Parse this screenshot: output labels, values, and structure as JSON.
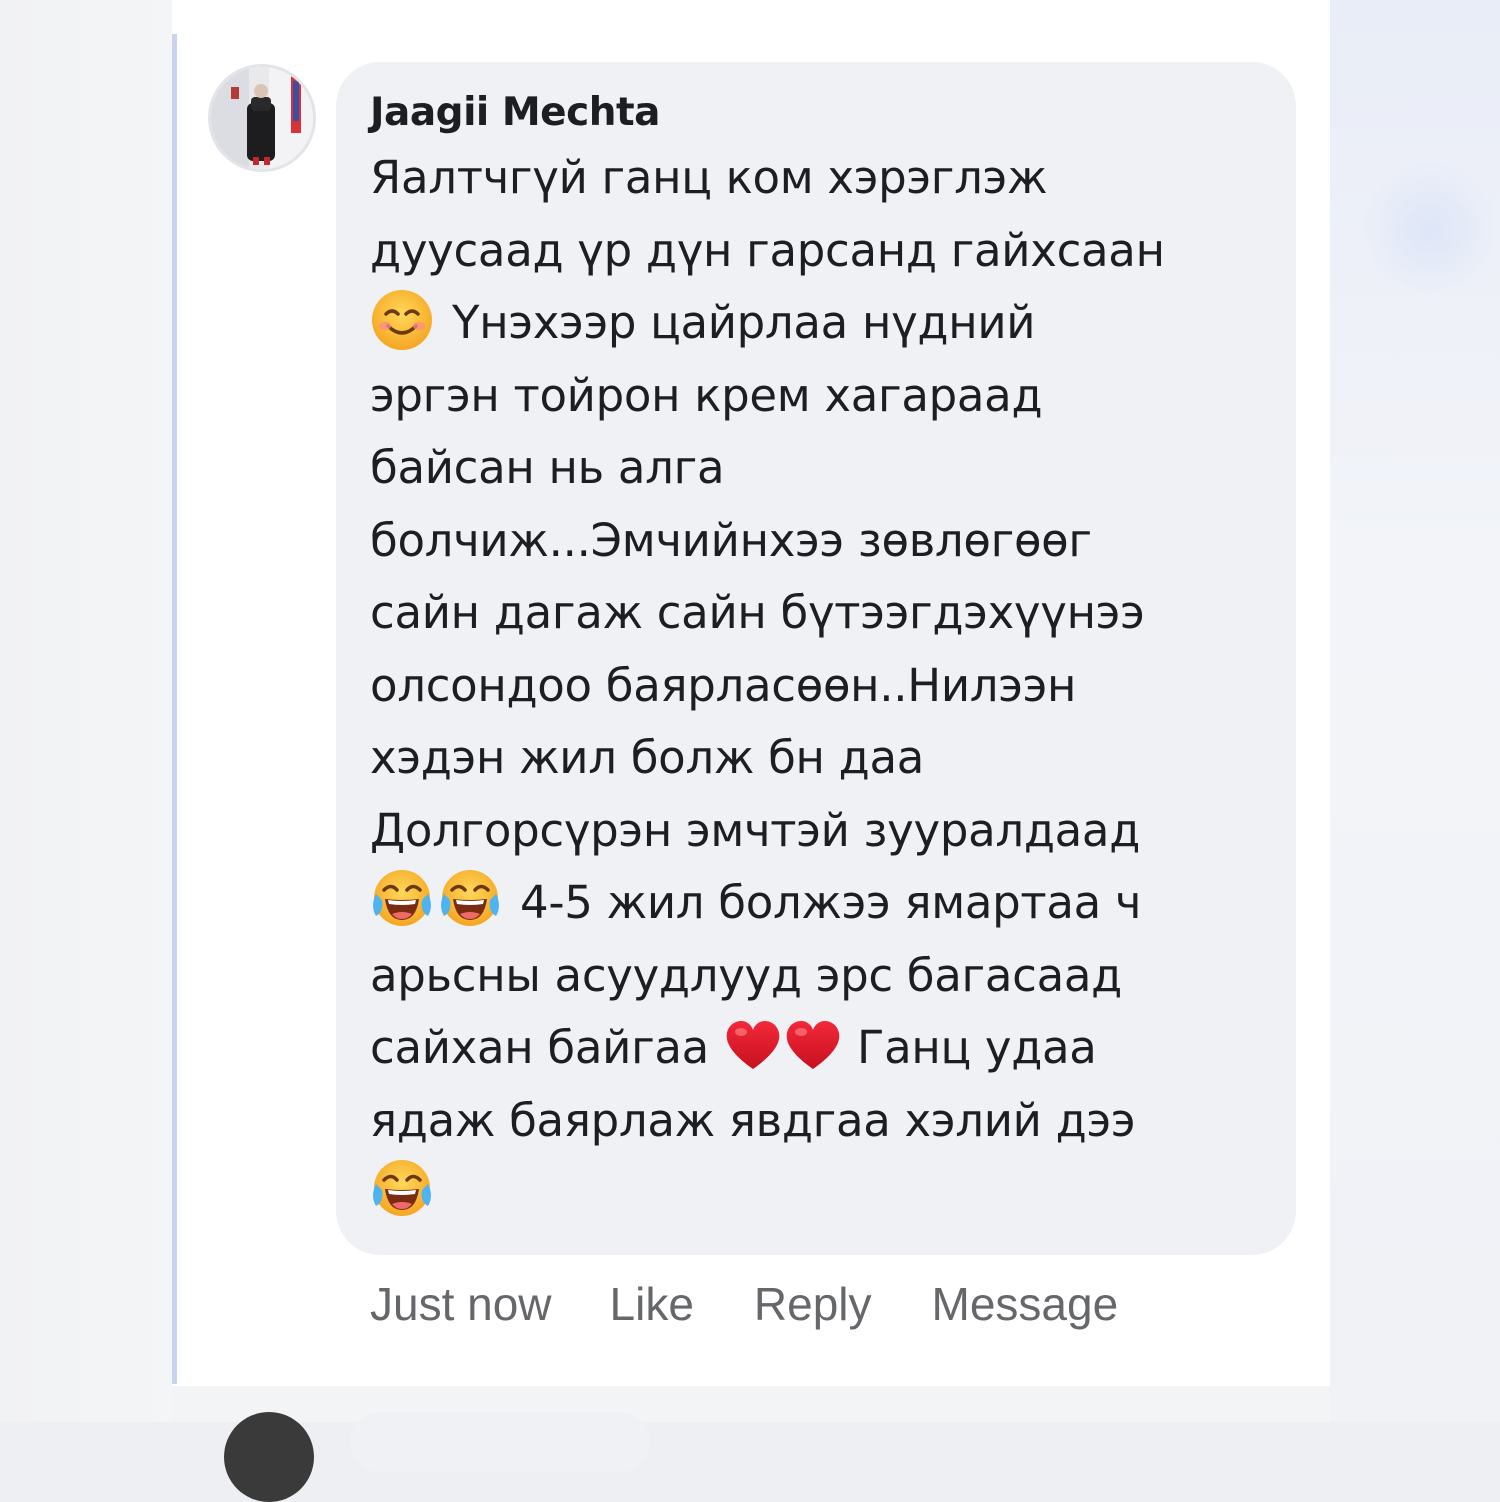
{
  "comment": {
    "author": "Jaagii Mechta",
    "text_lines": [
      "Яалтчгүй ганц ком хэрэглэж",
      "дуусаад үр дүн гарсанд гайхсаан",
      "Үнэхээр цайрлаа нүдний",
      "эргэн тойрон крем хагараад",
      "байсан нь алга",
      "болчиж...Эмчийнхээ зөвлөгөөг",
      "сайн дагаж сайн бүтээгдэхүүнээ",
      "олсондоо баярласөөн..Нилээн",
      "хэдэн жил болж бн даа",
      "Долгорсүрэн эмчтэй зууралдаад",
      "4-5 жил болжээ ямартаа ч",
      "арьсны асуудлууд эрс багасаад",
      "сайхан байгаа",
      "Ганц удаа",
      "ядаж баярлаж явдгаа хэлий дээ"
    ],
    "emojis": {
      "smiling": "smiling-face-emoji",
      "laughing": "face-with-tears-of-joy-emoji",
      "heart": "red-heart-emoji"
    }
  },
  "actions": {
    "timestamp": "Just now",
    "like": "Like",
    "reply": "Reply",
    "message": "Message"
  },
  "colors": {
    "bubble": "#f0f1f5",
    "thread_line": "#c9d3ee",
    "text": "#1c1e21",
    "secondary_text": "#65676b"
  }
}
